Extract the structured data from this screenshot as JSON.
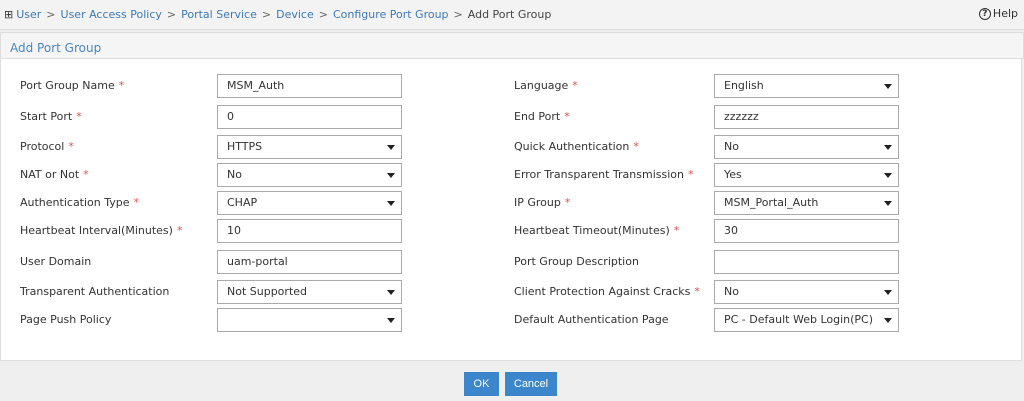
{
  "breadcrumb": {
    "items": [
      "User",
      "User Access Policy",
      "Portal Service",
      "Device",
      "Configure Port Group"
    ],
    "current": "Add Port Group"
  },
  "help": "Help",
  "section_title": "Add Port Group",
  "left": [
    {
      "label": "Port Group Name",
      "required": true,
      "value": "MSM_Auth",
      "type": "input"
    },
    {
      "label": "Start Port",
      "required": true,
      "value": "0",
      "type": "input"
    },
    {
      "label": "Protocol",
      "required": true,
      "value": "HTTPS",
      "type": "select"
    },
    {
      "label": "NAT or Not",
      "required": true,
      "value": "No",
      "type": "select"
    },
    {
      "label": "Authentication Type",
      "required": true,
      "value": "CHAP",
      "type": "select"
    },
    {
      "label": "Heartbeat Interval(Minutes)",
      "required": true,
      "value": "10",
      "type": "input"
    },
    {
      "label": "User Domain",
      "required": false,
      "value": "uam-portal",
      "type": "input"
    },
    {
      "label": "Transparent Authentication",
      "required": false,
      "value": "Not Supported",
      "type": "select"
    },
    {
      "label": "Page Push Policy",
      "required": false,
      "value": "",
      "type": "select"
    }
  ],
  "right": [
    {
      "label": "Language",
      "required": true,
      "value": "English",
      "type": "select"
    },
    {
      "label": "End Port",
      "required": true,
      "value": "zzzzzz",
      "type": "input"
    },
    {
      "label": "Quick Authentication",
      "required": true,
      "value": "No",
      "type": "select"
    },
    {
      "label": "Error Transparent Transmission",
      "required": true,
      "value": "Yes",
      "type": "select"
    },
    {
      "label": "IP Group",
      "required": true,
      "value": "MSM_Portal_Auth",
      "type": "select"
    },
    {
      "label": "Heartbeat Timeout(Minutes)",
      "required": true,
      "value": "30",
      "type": "input"
    },
    {
      "label": "Port Group Description",
      "required": false,
      "value": "",
      "type": "input"
    },
    {
      "label": "Client Protection Against Cracks",
      "required": true,
      "value": "No",
      "type": "select"
    },
    {
      "label": "Default Authentication Page",
      "required": false,
      "value": "PC - Default Web Login(PC)",
      "type": "select"
    }
  ],
  "buttons": {
    "ok": "OK",
    "cancel": "Cancel"
  }
}
